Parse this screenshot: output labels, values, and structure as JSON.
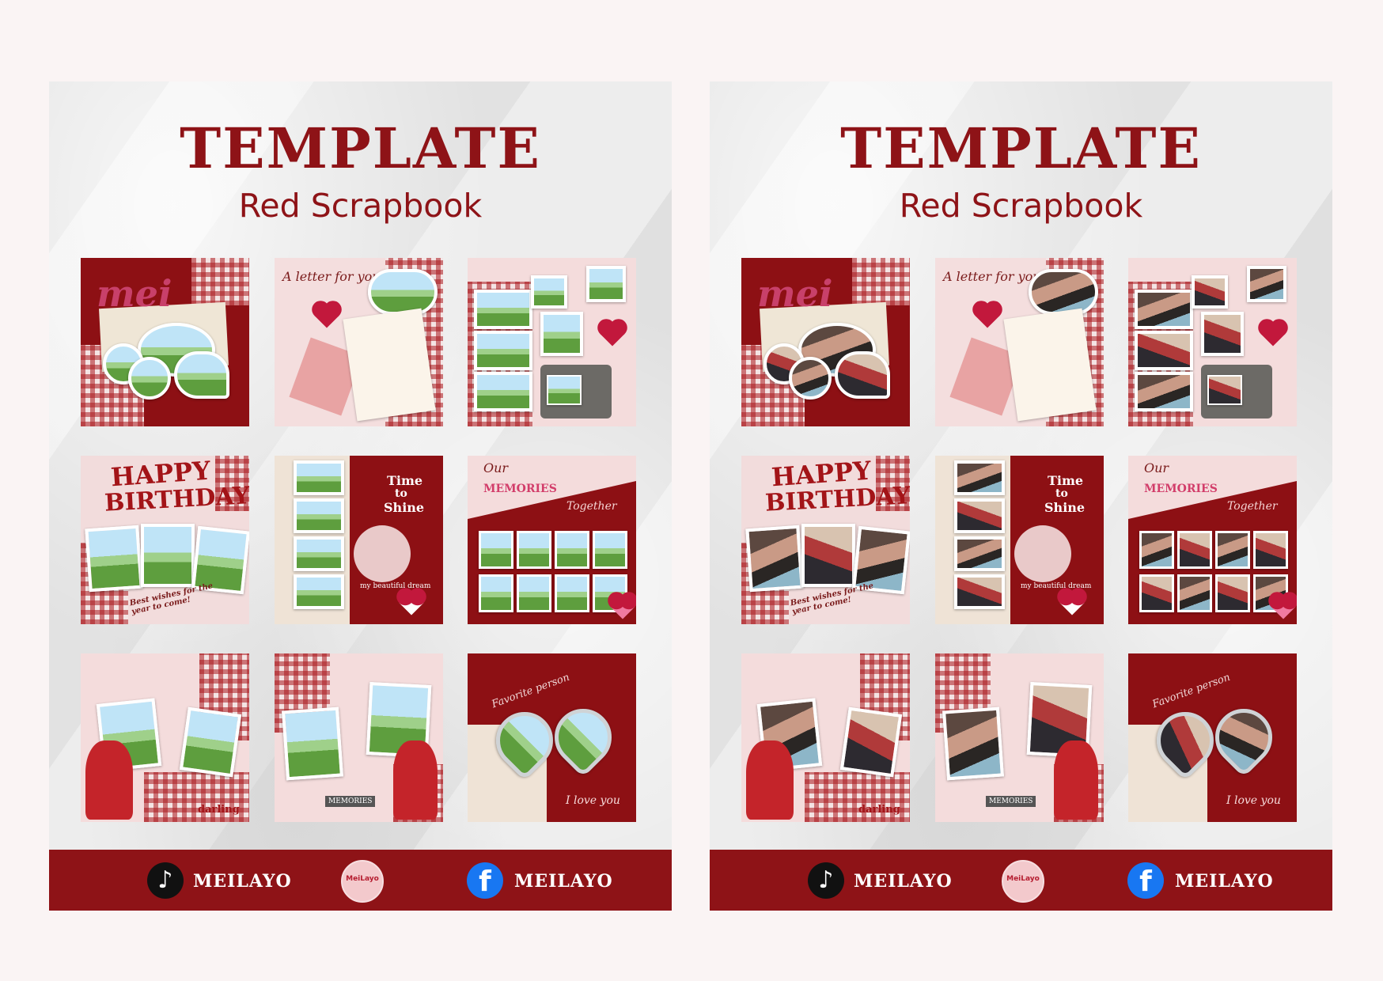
{
  "panels": [
    {
      "title": "TEMPLATE",
      "subtitle": "Red Scrapbook",
      "tiles": {
        "t0": {
          "text": "mei"
        },
        "t1": {
          "text": "A letter for you"
        },
        "t3": {
          "line1": "HAPPY",
          "line2": "BIRTHDAY",
          "note": "Best wishes for the year to come!"
        },
        "t4": {
          "text1": "Time",
          "text2": "to",
          "text3": "Shine",
          "text4": "my beautiful dream"
        },
        "t5": {
          "text1": "Our",
          "text2": "MEMORIES",
          "text3": "Together"
        },
        "t6": {
          "text": "darling"
        },
        "t7": {
          "text": "MEMORIES"
        },
        "t8": {
          "text1": "Favorite person",
          "text2": "I love you"
        }
      },
      "footer": {
        "tiktok": "MEILAYO",
        "logo": "MeiLayo",
        "facebook": "MEILAYO"
      }
    },
    {
      "title": "TEMPLATE",
      "subtitle": "Red Scrapbook",
      "tiles": {
        "t0": {
          "text": "mei"
        },
        "t1": {
          "text": "A letter for you"
        },
        "t3": {
          "line1": "HAPPY",
          "line2": "BIRTHDAY",
          "note": "Best wishes for the year to come!"
        },
        "t4": {
          "text1": "Time",
          "text2": "to",
          "text3": "Shine",
          "text4": "my beautiful dream"
        },
        "t5": {
          "text1": "Our",
          "text2": "MEMORIES",
          "text3": "Together"
        },
        "t6": {
          "text": "darling"
        },
        "t7": {
          "text": "MEMORIES"
        },
        "t8": {
          "text1": "Favorite person",
          "text2": "I love you"
        }
      },
      "footer": {
        "tiktok": "MEILAYO",
        "logo": "MeiLayo",
        "facebook": "MEILAYO"
      }
    }
  ],
  "icons": [
    "tiktok-icon",
    "facebook-icon",
    "heart-icon",
    "camera-icon"
  ],
  "colors": {
    "brand_red": "#8e1317",
    "background": "#faf4f4",
    "paper": "#e9e9e9"
  }
}
